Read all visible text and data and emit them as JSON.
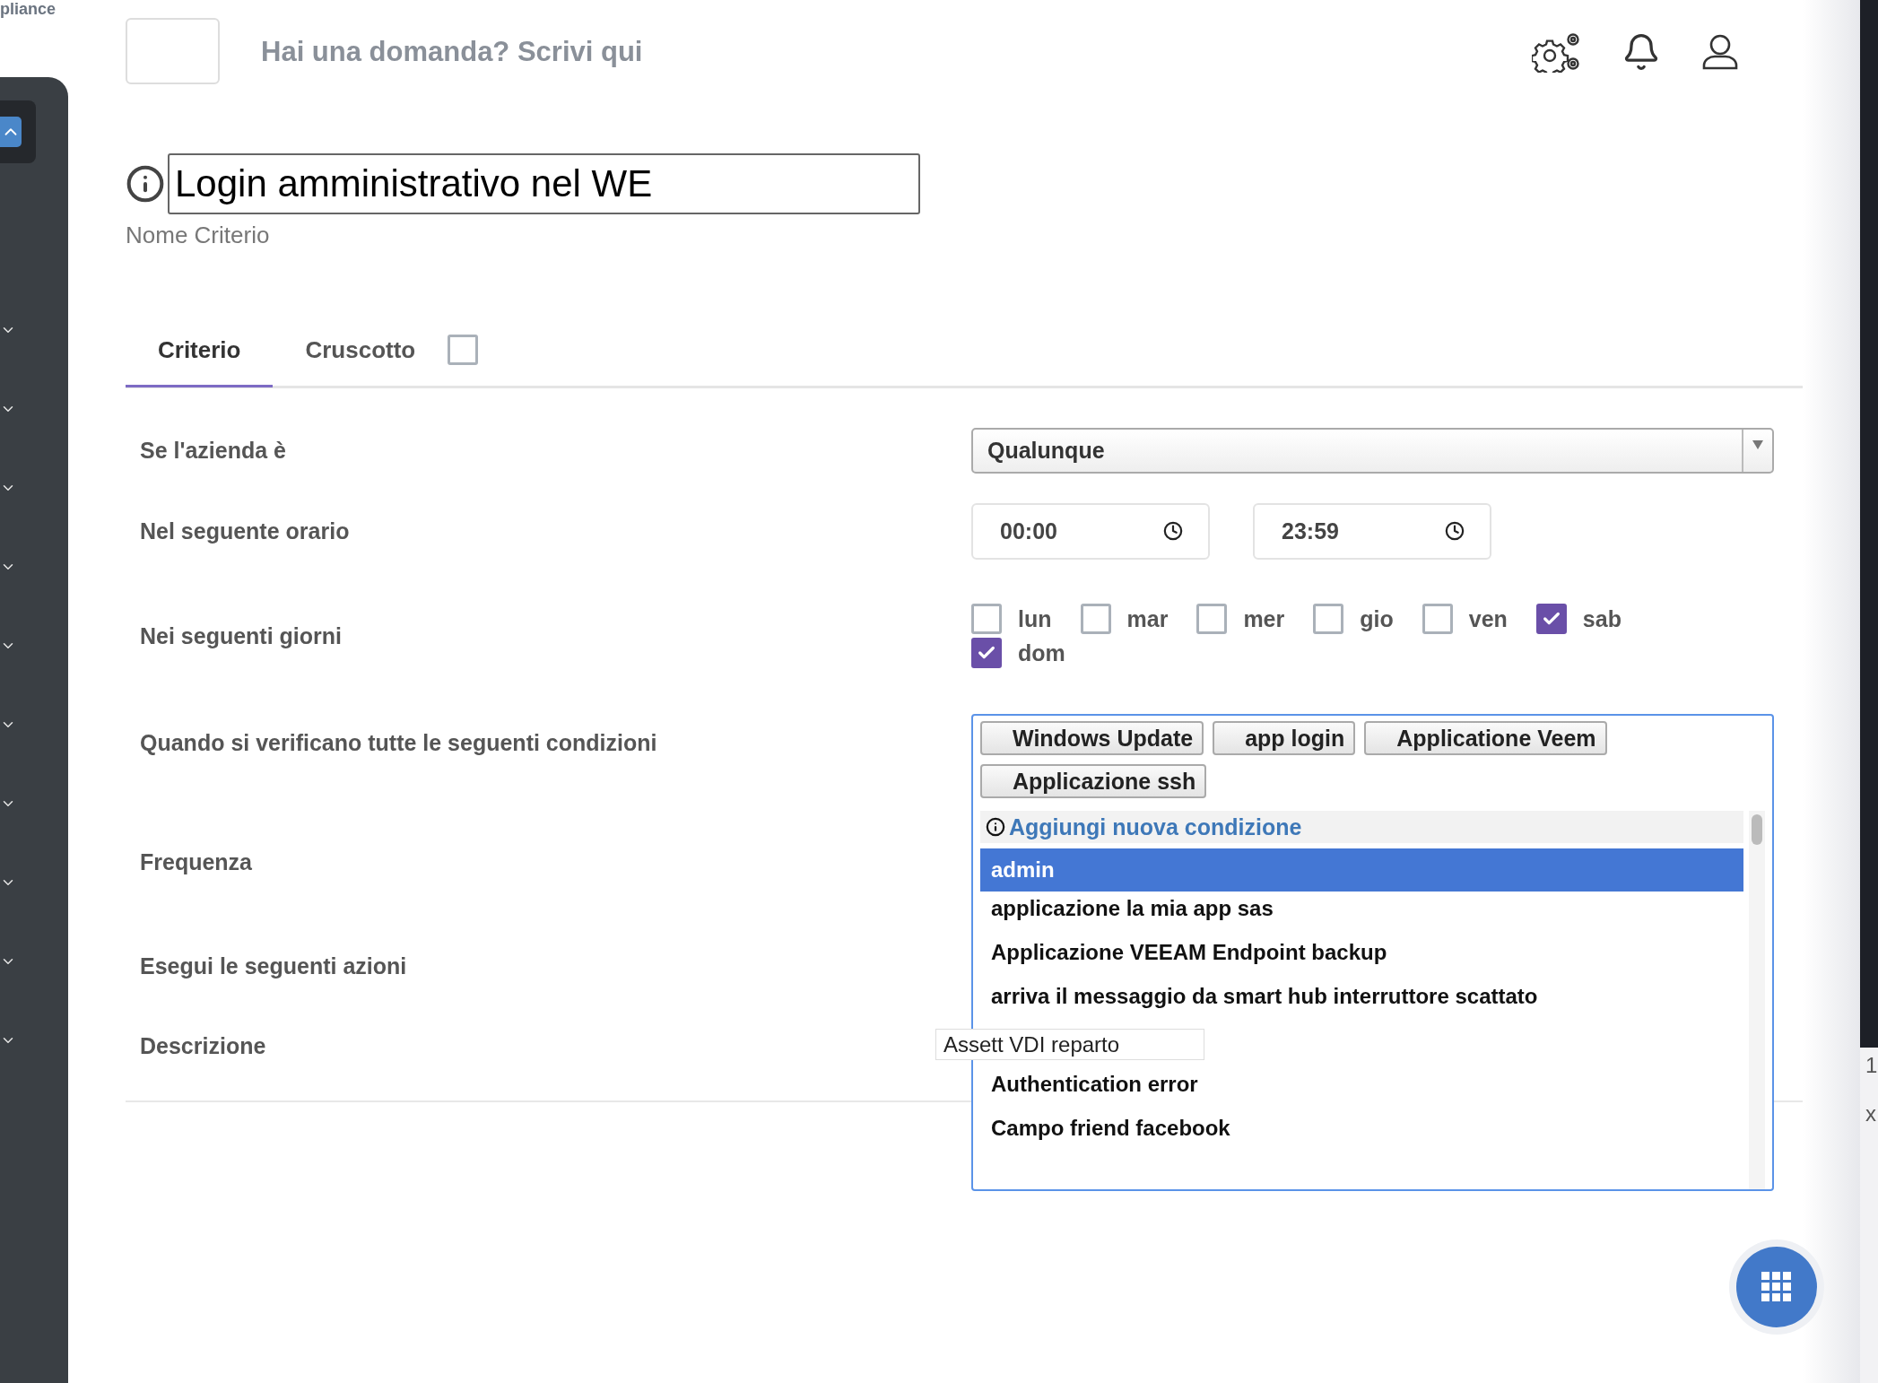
{
  "sidebar": {
    "top_text": "pliance",
    "sections": [
      {
        "expanded": true
      },
      {
        "expanded": false
      },
      {
        "expanded": false
      },
      {
        "expanded": false
      },
      {
        "expanded": false
      },
      {
        "expanded": false
      },
      {
        "expanded": false
      },
      {
        "expanded": false
      },
      {
        "expanded": false
      },
      {
        "expanded": false
      },
      {
        "expanded": false
      }
    ]
  },
  "header": {
    "search_placeholder": "Hai una domanda? Scrivi qui"
  },
  "criterion": {
    "name": "Login amministrativo nel WE",
    "name_label": "Nome Criterio"
  },
  "tabs": [
    {
      "label": "Criterio",
      "selected": true
    },
    {
      "label": "Cruscotto",
      "selected": false
    }
  ],
  "dashboard_checkbox": {
    "checked": false
  },
  "form": [
    {
      "label": "Se l'azienda è",
      "kind": "select",
      "value": "Qualunque"
    },
    {
      "label": "Nel seguente orario",
      "kind": "time_range",
      "from": "00:00",
      "to": "23:59"
    },
    {
      "label": "Nei seguenti giorni",
      "kind": "days",
      "days": [
        {
          "label": "lun",
          "checked": false
        },
        {
          "label": "mar",
          "checked": false
        },
        {
          "label": "mer",
          "checked": false
        },
        {
          "label": "gio",
          "checked": false
        },
        {
          "label": "ven",
          "checked": false
        },
        {
          "label": "sab",
          "checked": true
        },
        {
          "label": "dom",
          "checked": true
        }
      ]
    },
    {
      "label": "Quando si verificano tutte le seguenti condizioni",
      "kind": "conditions",
      "tags": [
        "Windows Update",
        "app login",
        "Applicatione Veem",
        "Applicazione ssh"
      ],
      "dropdown": {
        "header": "Aggiungi nuova condizione",
        "options": [
          {
            "kind": "option",
            "label": "admin",
            "selected": true
          },
          {
            "kind": "option",
            "label": "applicazione la mia app sas",
            "selected": false
          },
          {
            "kind": "option",
            "label": "Applicazione VEEAM Endpoint backup",
            "selected": false
          },
          {
            "kind": "option",
            "label": "arriva il messaggio da smart hub interruttore scattato",
            "selected": false
          },
          {
            "kind": "tooltip",
            "label": "Assett VDI reparto",
            "selected": false
          },
          {
            "kind": "option",
            "label": "Authentication error",
            "selected": false
          },
          {
            "kind": "option",
            "label": "Campo friend facebook",
            "selected": false
          }
        ]
      }
    },
    {
      "label": "Frequenza",
      "kind": "empty"
    },
    {
      "label": "Esegui le seguenti azioni",
      "kind": "empty"
    },
    {
      "label": "Descrizione",
      "kind": "empty"
    }
  ],
  "edge_fragments": [
    "1",
    "x"
  ]
}
